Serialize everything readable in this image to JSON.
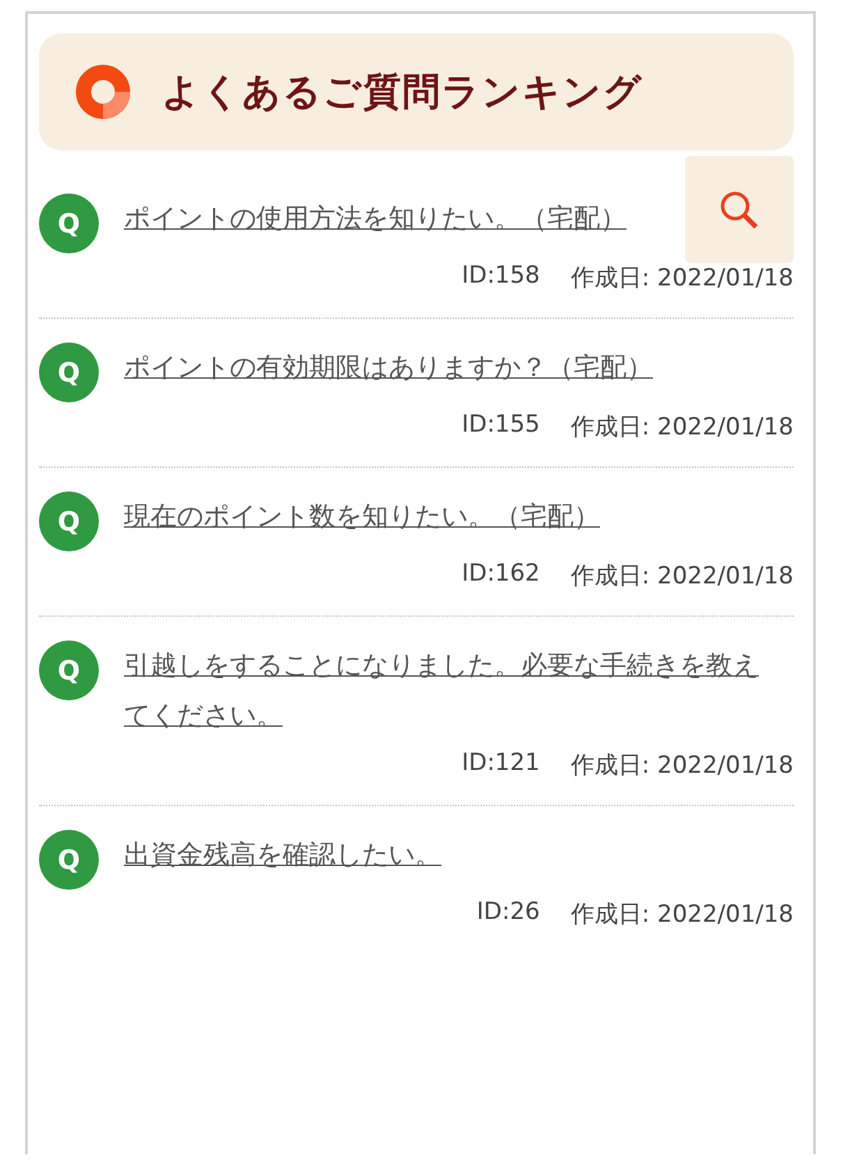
{
  "header": {
    "title": "よくあるご質問ランキング"
  },
  "questions": [
    {
      "badge": "Q",
      "text": "ポイントの使用方法を知りたい。（宅配）",
      "id": "ID:158",
      "date": "作成日: 2022/01/18"
    },
    {
      "badge": "Q",
      "text": "ポイントの有効期限はありますか？（宅配）",
      "id": "ID:155",
      "date": "作成日: 2022/01/18"
    },
    {
      "badge": "Q",
      "text": "現在のポイント数を知りたい。（宅配）",
      "id": "ID:162",
      "date": "作成日: 2022/01/18"
    },
    {
      "badge": "Q",
      "text": "引越しをすることになりました。必要な手続きを教えてください。",
      "id": "ID:121",
      "date": "作成日: 2022/01/18"
    },
    {
      "badge": "Q",
      "text": "出資金残高を確認したい。",
      "id": "ID:26",
      "date": "作成日: 2022/01/18"
    }
  ]
}
